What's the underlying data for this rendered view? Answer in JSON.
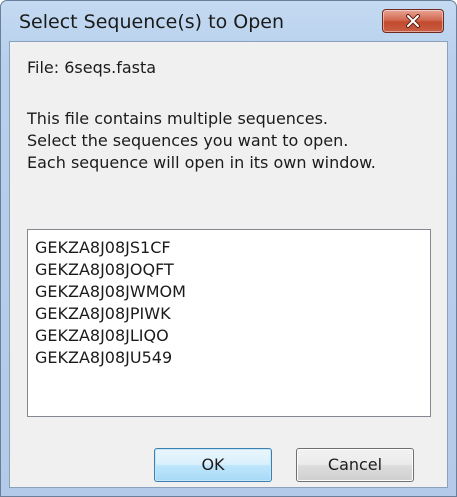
{
  "window": {
    "title": "Select Sequence(s) to Open"
  },
  "file": {
    "label": "File: 6seqs.fasta"
  },
  "message": {
    "line1": "This file contains multiple sequences.",
    "line2": "Select the sequences you want to open.",
    "line3": "Each sequence will open in its own window."
  },
  "sequences": [
    "GEKZA8J08JS1CF",
    "GEKZA8J08JOQFT",
    "GEKZA8J08JWMOM",
    "GEKZA8J08JPIWK",
    "GEKZA8J08JLIQO",
    "GEKZA8J08JU549"
  ],
  "buttons": {
    "ok": "OK",
    "cancel": "Cancel"
  },
  "icons": {
    "close": "close-icon"
  }
}
